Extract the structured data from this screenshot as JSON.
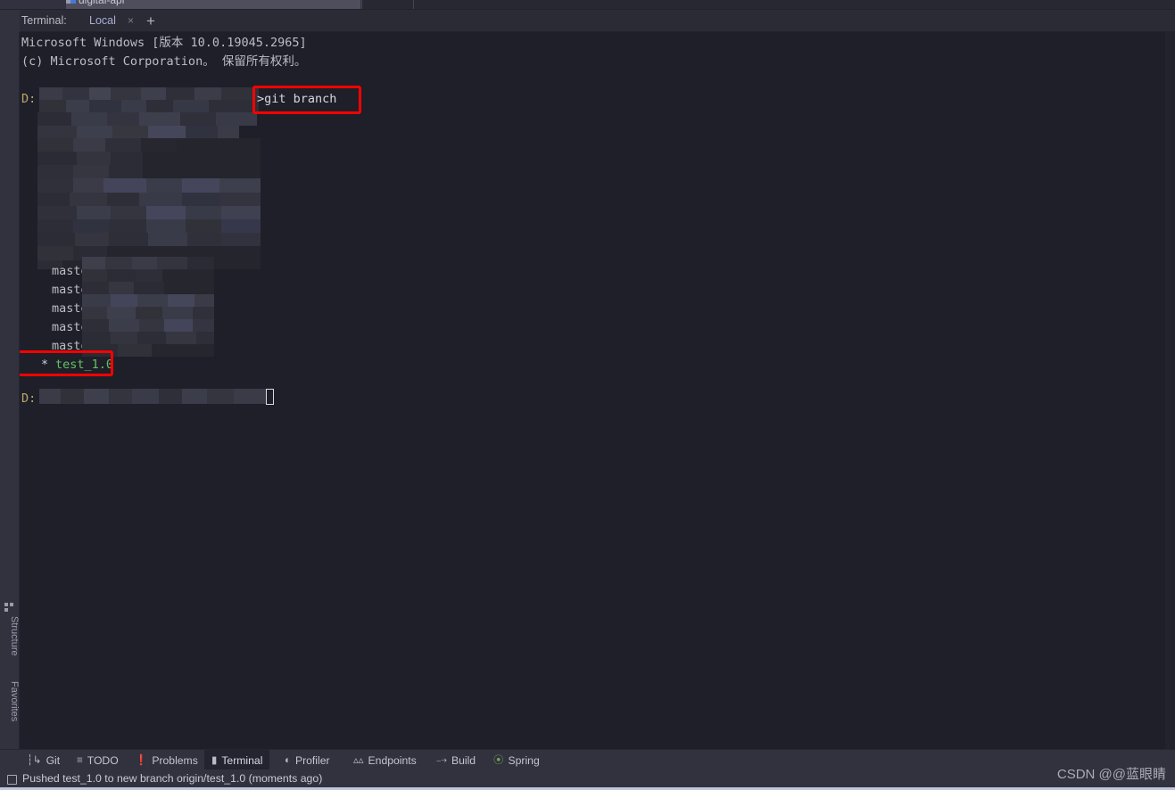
{
  "window": {
    "background_color": "#1e1f28",
    "panel_color": "#32323f",
    "accent_color": "#8f7fd0"
  },
  "editor_tab_strip": {
    "tab_label": "digital-api",
    "icon": "module-icon"
  },
  "terminal_header": {
    "label": "Terminal:",
    "tab_label": "Local",
    "close_icon": "×",
    "add_icon": "+"
  },
  "left_sidebar": {
    "items": [
      {
        "label": "Structure",
        "icon": "structure-icon"
      },
      {
        "label": "Favorites",
        "icon": "star-icon"
      }
    ]
  },
  "terminal": {
    "lines": [
      {
        "text": "Microsoft Windows [版本 10.0.19045.2965]",
        "color": "normal"
      },
      {
        "text": "(c) Microsoft Corporation。 保留所有权利。",
        "color": "normal"
      }
    ],
    "prompt_drive": "D:",
    "command": ">git branch",
    "branches": [
      {
        "name": "master",
        "current": false,
        "redacted": true
      },
      {
        "name": "master_",
        "current": false,
        "redacted": true
      },
      {
        "name": "master",
        "current": false,
        "redacted": true
      },
      {
        "name": "master",
        "current": false,
        "redacted": true
      },
      {
        "name": "master_",
        "current": false,
        "redacted": true
      },
      {
        "name": "test_1.0",
        "current": true,
        "redacted": false
      }
    ],
    "current_branch_marker": "*",
    "current_branch_name": "test_1.0",
    "current_branch_color": "#63c267",
    "final_prompt_drive": "D:",
    "cursor": "block"
  },
  "annotations": [
    {
      "target": "git-branch-command",
      "color": "#ff0000"
    },
    {
      "target": "current-branch-test-1-0",
      "color": "#ff0000"
    }
  ],
  "bottom_toolbar": {
    "items": [
      {
        "label": "Git",
        "icon": "git-branch-icon",
        "active": false
      },
      {
        "label": "TODO",
        "icon": "list-icon",
        "active": false
      },
      {
        "label": "Problems",
        "icon": "warning-icon",
        "active": false
      },
      {
        "label": "Terminal",
        "icon": "terminal-icon",
        "active": true
      },
      {
        "label": "Profiler",
        "icon": "profiler-icon",
        "active": false
      },
      {
        "label": "Endpoints",
        "icon": "endpoints-icon",
        "active": false
      },
      {
        "label": "Build",
        "icon": "hammer-icon",
        "active": false
      },
      {
        "label": "Spring",
        "icon": "spring-leaf-icon",
        "active": false
      }
    ]
  },
  "status_bar": {
    "icon": "notification-icon",
    "message": "Pushed test_1.0 to new branch origin/test_1.0 (moments ago)"
  },
  "watermark": {
    "text": "CSDN @@蓝眼睛"
  }
}
